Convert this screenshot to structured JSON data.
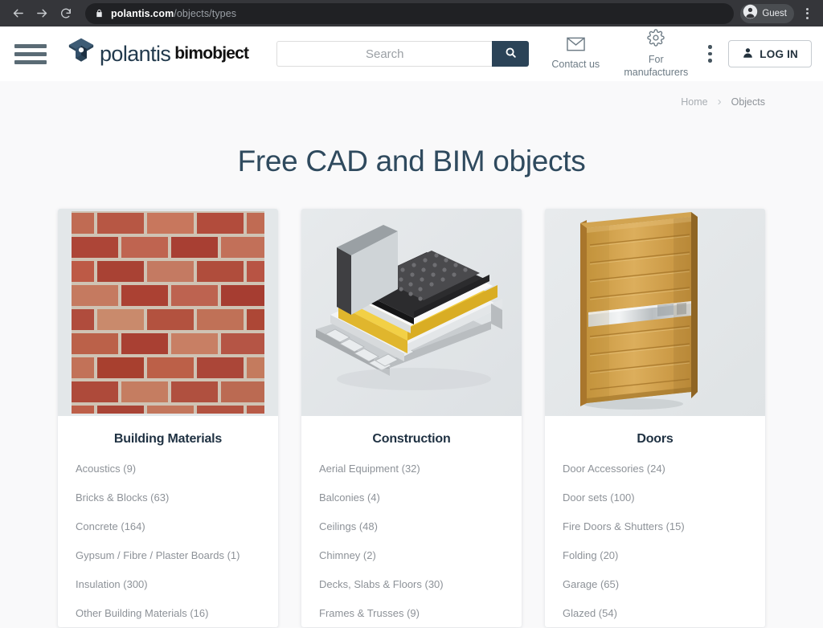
{
  "browser": {
    "back_icon": "back-arrow-icon",
    "forward_icon": "forward-arrow-icon",
    "reload_icon": "reload-icon",
    "lock_icon": "lock-icon",
    "url_host": "polantis.com",
    "url_path": "/objects/types",
    "profile_name": "Guest",
    "profile_icon": "account-avatar-icon",
    "menu_icon": "kebab-menu-icon"
  },
  "header": {
    "menu_icon": "hamburger-menu-icon",
    "logo_mark": "polantis-cube-logo-icon",
    "logo_text": "polantis",
    "logo_text_secondary": "bimobject",
    "search": {
      "placeholder": "Search",
      "value": "",
      "button_icon": "search-icon"
    },
    "actions": [
      {
        "icon": "envelope-icon",
        "label": "Contact us"
      },
      {
        "icon": "gear-icon",
        "label": "For manufacturers"
      }
    ],
    "more_icon": "vertical-dots-icon",
    "login": {
      "label": "LOG IN",
      "icon": "user-icon"
    }
  },
  "breadcrumb": {
    "home": "Home",
    "separator": "›",
    "current": "Objects"
  },
  "main": {
    "title": "Free CAD and BIM objects",
    "cards": [
      {
        "title": "Building Materials",
        "image": "brick-wall-image",
        "items": [
          "Acoustics (9)",
          "Bricks & Blocks (63)",
          "Concrete (164)",
          "Gypsum / Fibre / Plaster Boards (1)",
          "Insulation (300)",
          "Other Building Materials (16)"
        ]
      },
      {
        "title": "Construction",
        "image": "roof-slab-assembly-image",
        "items": [
          "Aerial Equipment (32)",
          "Balconies (4)",
          "Ceilings (48)",
          "Chimney (2)",
          "Decks, Slabs & Floors (30)",
          "Frames & Trusses (9)"
        ]
      },
      {
        "title": "Doors",
        "image": "wooden-door-image",
        "items": [
          "Door Accessories (24)",
          "Door sets (100)",
          "Fire Doors & Shutters (15)",
          "Folding (20)",
          "Garage (65)",
          "Glazed (54)"
        ]
      }
    ]
  },
  "colors": {
    "brand_dark": "#2b4357",
    "page_bg": "#f9f9fa",
    "chrome_bg": "#35363a",
    "omnibox_bg": "#202124",
    "card_img_bg": "#e3e7e9",
    "text_muted": "#8d9298",
    "title": "#2f4a5e"
  }
}
